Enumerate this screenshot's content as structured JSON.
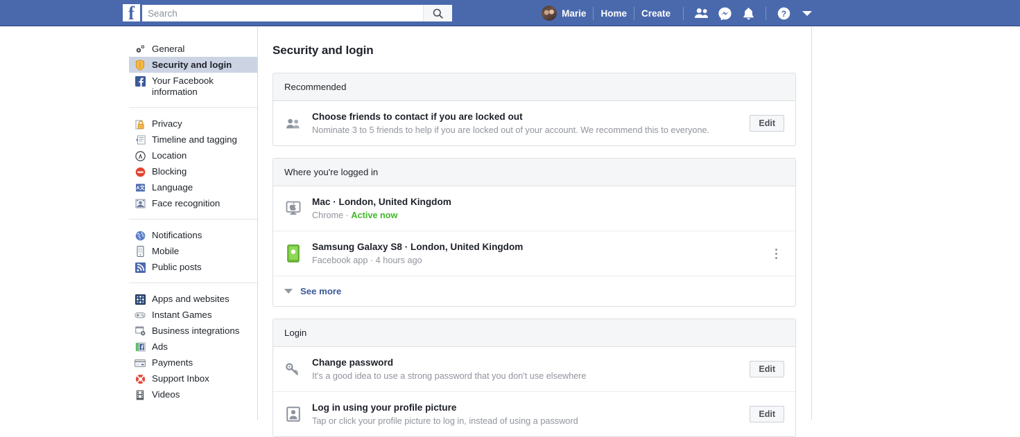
{
  "topbar": {
    "logo_icon": "facebook-f-logo",
    "search": {
      "value": "",
      "placeholder": "Search",
      "icon": "search-icon"
    },
    "profile_name": "Marie",
    "home_label": "Home",
    "create_label": "Create",
    "icons": [
      "friend-requests-icon",
      "messenger-icon",
      "notifications-bell-icon",
      "help-question-icon",
      "account-caret-down-icon"
    ],
    "bg_color": "#4a69ad"
  },
  "sidebar": {
    "groups": [
      {
        "items": [
          {
            "label": "General",
            "icon": "gears-icon",
            "active": false
          },
          {
            "label": "Security and login",
            "icon": "shield-icon",
            "active": true
          },
          {
            "label": "Your Facebook information",
            "icon": "facebook-square-icon",
            "active": false
          }
        ]
      },
      {
        "items": [
          {
            "label": "Privacy",
            "icon": "padlock-icon",
            "active": false
          },
          {
            "label": "Timeline and tagging",
            "icon": "timeline-icon",
            "active": false
          },
          {
            "label": "Location",
            "icon": "location-circle-icon",
            "active": false
          },
          {
            "label": "Blocking",
            "icon": "block-icon",
            "active": false
          },
          {
            "label": "Language",
            "icon": "language-icon",
            "active": false
          },
          {
            "label": "Face recognition",
            "icon": "face-recognition-icon",
            "active": false
          }
        ]
      },
      {
        "items": [
          {
            "label": "Notifications",
            "icon": "globe-icon",
            "active": false
          },
          {
            "label": "Mobile",
            "icon": "mobile-phone-icon",
            "active": false
          },
          {
            "label": "Public posts",
            "icon": "rss-icon",
            "active": false
          }
        ]
      },
      {
        "items": [
          {
            "label": "Apps and websites",
            "icon": "apps-grid-icon",
            "active": false
          },
          {
            "label": "Instant Games",
            "icon": "gamepad-icon",
            "active": false
          },
          {
            "label": "Business integrations",
            "icon": "business-gear-icon",
            "active": false
          },
          {
            "label": "Ads",
            "icon": "ads-icon",
            "active": false
          },
          {
            "label": "Payments",
            "icon": "credit-card-icon",
            "active": false
          },
          {
            "label": "Support Inbox",
            "icon": "lifebuoy-icon",
            "active": false
          },
          {
            "label": "Videos",
            "icon": "film-strip-icon",
            "active": false
          }
        ]
      }
    ],
    "active_highlight_color": "#ccd4e4"
  },
  "main": {
    "page_title": "Security and login",
    "sections": [
      {
        "header": "Recommended",
        "rows": [
          {
            "icon": "two-people-icon",
            "title": "Choose friends to contact if you are locked out",
            "subtitle": "Nominate 3 to 5 friends to help if you are locked out of your account. We recommend this to everyone.",
            "action": "Edit",
            "action_type": "button"
          }
        ]
      },
      {
        "header": "Where you're logged in",
        "rows": [
          {
            "icon": "mac-desktop-icon",
            "title": "Mac · London, United Kingdom",
            "sub_prefix": "Chrome · ",
            "sub_status": "Active now",
            "status_color": "#42b72a",
            "action_type": "none"
          },
          {
            "icon": "android-phone-icon",
            "title": "Samsung Galaxy S8 · London, United Kingdom",
            "subtitle": "Facebook app · 4 hours ago",
            "action_type": "kebab"
          }
        ],
        "footer": {
          "label": "See more",
          "icon": "caret-down-icon",
          "color": "#3b5998"
        }
      },
      {
        "header": "Login",
        "rows": [
          {
            "icon": "key-icon",
            "title": "Change password",
            "subtitle": "It's a good idea to use a strong password that you don't use elsewhere",
            "action": "Edit",
            "action_type": "button"
          },
          {
            "icon": "profile-picture-badge-icon",
            "title": "Log in using your profile picture",
            "subtitle": "Tap or click your profile picture to log in, instead of using a password",
            "action": "Edit",
            "action_type": "button"
          }
        ]
      }
    ]
  }
}
